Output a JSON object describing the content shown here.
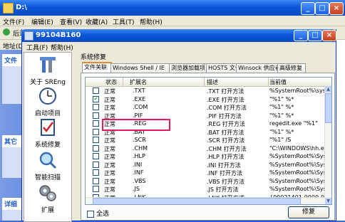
{
  "bg_window": {
    "title": "D:\\",
    "menu": [
      "文件(F)",
      "编辑(E)",
      "查看(V)",
      "收藏(A)",
      "工具(T)",
      "帮助(H)"
    ],
    "back_label": "后退",
    "addr_label": "地址(D)",
    "left_headers": [
      "文件",
      "其它",
      "详细"
    ]
  },
  "dialog": {
    "title": "99104B160",
    "menu": [
      "工具(F)",
      "帮助(H)"
    ],
    "section_label": "系统修复",
    "sidebar": [
      {
        "label": "关于 SREng",
        "icon": "tools-icon"
      },
      {
        "label": "启动项目",
        "icon": "clock-icon"
      },
      {
        "label": "系统修复",
        "icon": "checklist-icon"
      },
      {
        "label": "智能扫描",
        "icon": "magnifier-icon"
      },
      {
        "label": "扩展",
        "icon": "gears-icon"
      }
    ],
    "tabs": [
      "文件关联",
      "Windows Shell / IE",
      "浏览器加载项",
      "HOSTS 文件",
      "Winsock 供应者",
      "高级修复"
    ],
    "columns": [
      "状态",
      "扩展名",
      "描述",
      "当前值"
    ],
    "rows": [
      {
        "checked": false,
        "status": "正常",
        "ext": ".TXT",
        "desc": ".TXT 打开方法",
        "value": "%SystemRoot%\\system32\\"
      },
      {
        "checked": true,
        "status": "正常",
        "ext": ".EXE",
        "desc": ".EXE 打开方法",
        "value": "\"%1\" %*"
      },
      {
        "checked": false,
        "status": "正常",
        "ext": ".COM",
        "desc": ".COM 打开方法",
        "value": "\"%1\" %*"
      },
      {
        "checked": false,
        "status": "正常",
        "ext": ".PIF",
        "desc": ".PIF 打开方法",
        "value": "\"%1\" %*"
      },
      {
        "checked": false,
        "status": "正常",
        "ext": ".REG",
        "desc": ".REG 打开方法",
        "value": "regedit.exe \"%1\""
      },
      {
        "checked": false,
        "status": "正常",
        "ext": ".BAT",
        "desc": ".BAT 打开方法",
        "value": "\"%1\" %*"
      },
      {
        "checked": false,
        "status": "正常",
        "ext": ".SCR",
        "desc": ".SCR 打开方法",
        "value": "\"%1\" /S"
      },
      {
        "checked": false,
        "status": "正常",
        "ext": ".CHM",
        "desc": ".CHM 打开方法",
        "value": "\"C:\\WINDOWS\\hh.exe\" %1"
      },
      {
        "checked": false,
        "status": "正常",
        "ext": ".HLP",
        "desc": ".HLP 打开方法",
        "value": "%SystemRoot%\\System32\\"
      },
      {
        "checked": false,
        "status": "正常",
        "ext": ".INI",
        "desc": ".INI 打开方法",
        "value": "%SystemRoot%\\System32\\"
      },
      {
        "checked": false,
        "status": "正常",
        "ext": ".INF",
        "desc": ".INF 打开方法",
        "value": "%SystemRoot%\\System32\\"
      },
      {
        "checked": false,
        "status": "正常",
        "ext": ".VBS",
        "desc": ".VBS 打开方法",
        "value": "%SystemRoot%\\System32\\"
      },
      {
        "checked": false,
        "status": "正常",
        "ext": ".JS",
        "desc": ".JS 打开方法",
        "value": "%SystemRoot%\\System32\\"
      },
      {
        "checked": false,
        "status": "正常",
        "ext": ".LNK",
        "desc": ".LNK 打开方式",
        "value": "{00021401-0000-0000-C0"
      }
    ],
    "select_all_label": "全选",
    "fix_button": "修复"
  },
  "colors": {
    "xp_blue": "#0b56d8",
    "highlight_red": "#e8175d",
    "tab_accent": "#e68b2c"
  }
}
